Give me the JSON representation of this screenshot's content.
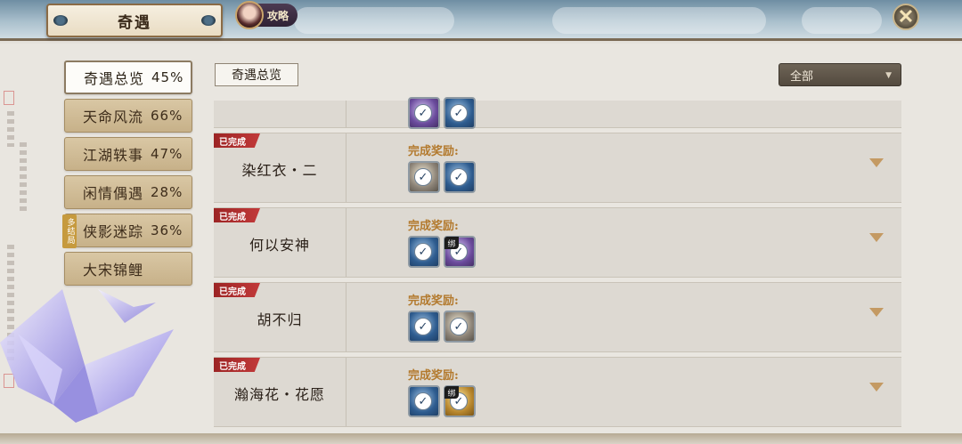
{
  "header": {
    "title": "奇遇",
    "guide_label": "攻略",
    "close_symbol": "✕"
  },
  "sidebar": {
    "items": [
      {
        "label": "奇遇总览",
        "percent": "45%",
        "active": true
      },
      {
        "label": "天命风流",
        "percent": "66%"
      },
      {
        "label": "江湖轶事",
        "percent": "47%"
      },
      {
        "label": "闲情偶遇",
        "percent": "28%"
      },
      {
        "label": "侠影迷踪",
        "percent": "36%",
        "badge": "多结局"
      },
      {
        "label": "大宋锦鲤",
        "percent": ""
      }
    ]
  },
  "main": {
    "section_label": "奇遇总览",
    "filter": {
      "selected": "全部",
      "arrow": "▼"
    },
    "rows": [
      {
        "name": "",
        "status": "",
        "reward_label": "",
        "rewards": [
          {
            "color": "purple"
          },
          {
            "color": "blue"
          }
        ]
      },
      {
        "name": "染红衣・二",
        "status": "已完成",
        "reward_label": "完成奖励:",
        "rewards": [
          {
            "color": "grey"
          },
          {
            "color": "blue"
          }
        ]
      },
      {
        "name": "何以安神",
        "status": "已完成",
        "reward_label": "完成奖励:",
        "rewards": [
          {
            "color": "blue"
          },
          {
            "color": "purple",
            "bound": "绑"
          }
        ]
      },
      {
        "name": "胡不归",
        "status": "已完成",
        "reward_label": "完成奖励:",
        "rewards": [
          {
            "color": "blue"
          },
          {
            "color": "grey"
          }
        ]
      },
      {
        "name": "瀚海花・花愿",
        "status": "已完成",
        "reward_label": "完成奖励:",
        "rewards": [
          {
            "color": "blue"
          },
          {
            "color": "gold",
            "bound": "绑"
          }
        ]
      }
    ]
  },
  "colors": {
    "completed_tag": "#9c2424",
    "reward_label": "#b37a2e",
    "accent_gold": "#c49a63"
  }
}
